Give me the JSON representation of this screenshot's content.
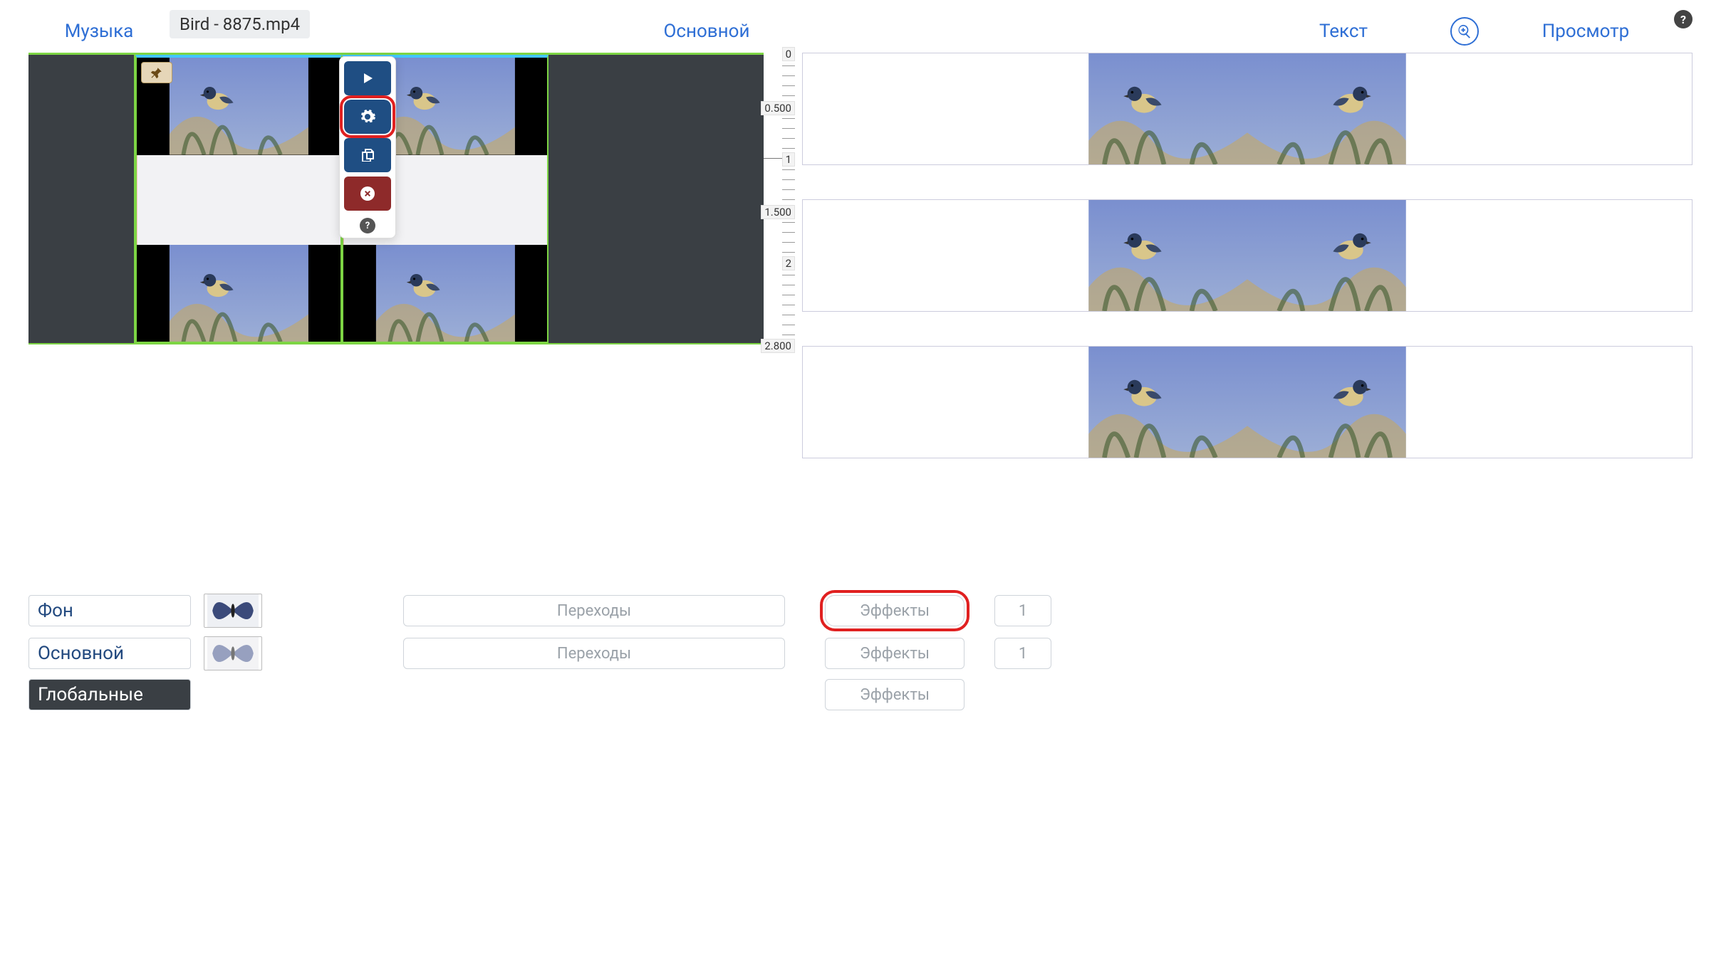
{
  "tabs": {
    "music": "Музыка",
    "main": "Основной",
    "text": "Текст",
    "preview": "Просмотр"
  },
  "file_chip": "Bird - 8875.mp4",
  "ruler": {
    "t0": "0",
    "t05": "0.500",
    "t1": "1",
    "t15": "1.500",
    "t2": "2",
    "t28": "2.800"
  },
  "actions": {
    "play": "play",
    "settings": "settings",
    "copy": "copy",
    "delete": "delete",
    "help": "?"
  },
  "help_top": "?",
  "bottom": {
    "rows": [
      {
        "layer": "Фон",
        "transitions": "Переходы",
        "effects": "Эффекты",
        "count": "1"
      },
      {
        "layer": "Основной",
        "transitions": "Переходы",
        "effects": "Эффекты",
        "count": "1"
      },
      {
        "layer": "Глобальные",
        "transitions": "",
        "effects": "Эффекты",
        "count": ""
      }
    ]
  }
}
